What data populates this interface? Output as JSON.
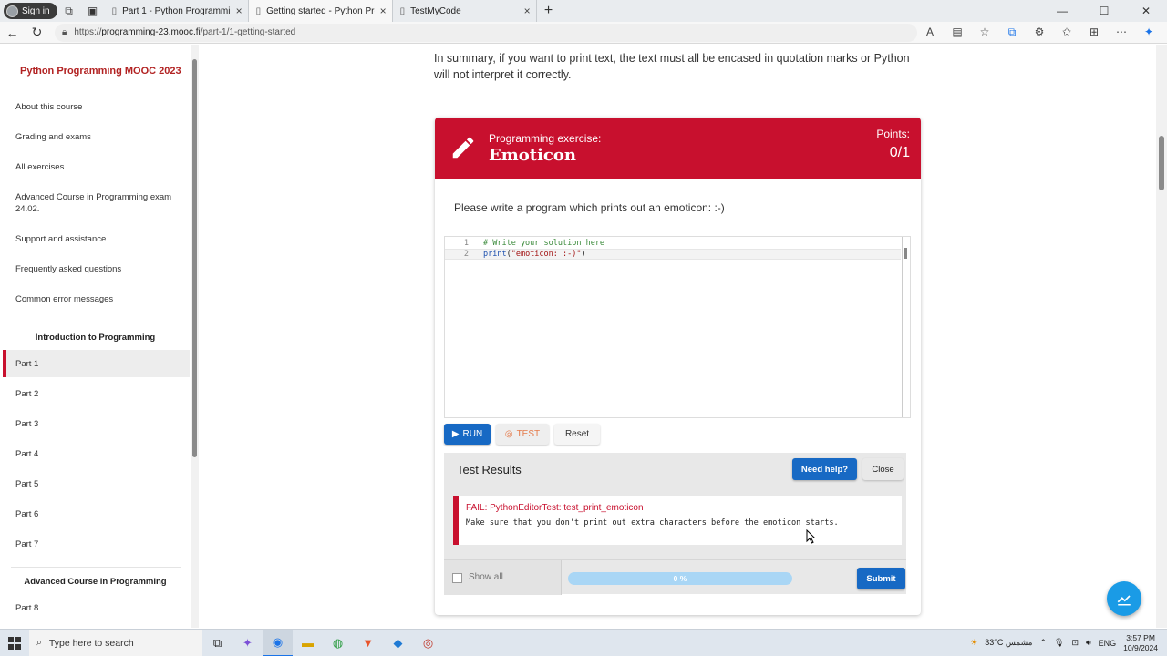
{
  "browser": {
    "signin_label": "Sign in",
    "tabs": [
      {
        "title": "Part 1 - Python Programming MC",
        "active": false
      },
      {
        "title": "Getting started - Python Program",
        "active": true
      },
      {
        "title": "TestMyCode",
        "active": false
      }
    ],
    "url_scheme": "https://",
    "url_host": "programming-23.mooc.fi",
    "url_path": "/part-1/1-getting-started"
  },
  "sidebar": {
    "title": "Python Programming MOOC 2023",
    "items": [
      "About this course",
      "Grading and exams",
      "All exercises",
      "Advanced Course in Programming exam 24.02.",
      "Support and assistance",
      "Frequently asked questions",
      "Common error messages"
    ],
    "section1": "Introduction to Programming",
    "parts": [
      "Part 1",
      "Part 2",
      "Part 3",
      "Part 4",
      "Part 5",
      "Part 6",
      "Part 7"
    ],
    "active_part": "Part 1",
    "section2": "Advanced Course in Programming",
    "parts2": [
      "Part 8"
    ]
  },
  "content": {
    "summary": "In summary, if you want to print text, the text must all be encased in quotation marks or Python will not interpret it correctly."
  },
  "exercise": {
    "kicker": "Programming exercise:",
    "title": "Emoticon",
    "points_label": "Points:",
    "points_value": "0/1",
    "prompt": "Please write a program which prints out an emoticon: :-)",
    "code_lines": [
      {
        "n": "1",
        "comment": "# Write your solution here"
      },
      {
        "n": "2",
        "kw": "print",
        "open": "(",
        "str": "\"emoticon: :-)\"",
        "close": ")"
      }
    ],
    "run_label": "RUN",
    "test_label": "TEST",
    "reset_label": "Reset"
  },
  "results": {
    "title": "Test Results",
    "help_label": "Need help?",
    "close_label": "Close",
    "fail_title": "FAIL: PythonEditorTest: test_print_emoticon",
    "fail_message": "Make sure that you don't print out extra characters before the emoticon starts.",
    "show_all_label": "Show all",
    "progress_percent": 0,
    "progress_label": "0 %",
    "submit_label": "Submit"
  },
  "taskbar": {
    "search_placeholder": "Type here to search",
    "weather": "33°C مشمس",
    "language": "ENG",
    "time": "3:57 PM",
    "date": "10/9/2024"
  },
  "colors": {
    "accent_red": "#c8102e",
    "button_blue": "#1769c4"
  }
}
